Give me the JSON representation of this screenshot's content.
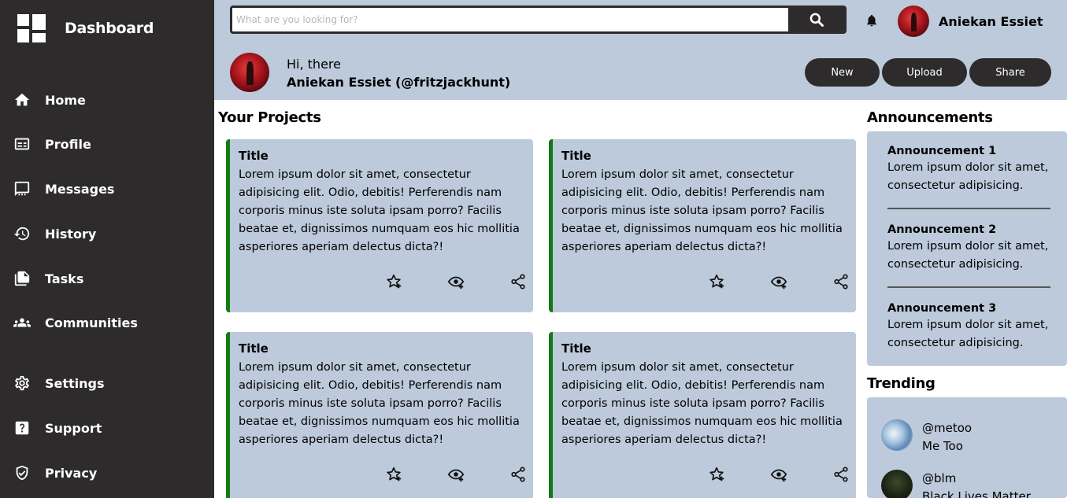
{
  "sidebar": {
    "brand_title": "Dashboard",
    "items": [
      {
        "label": "Home",
        "icon": "home-icon"
      },
      {
        "label": "Profile",
        "icon": "id-card-icon"
      },
      {
        "label": "Messages",
        "icon": "chat-icon"
      },
      {
        "label": "History",
        "icon": "history-icon"
      },
      {
        "label": "Tasks",
        "icon": "documents-icon"
      },
      {
        "label": "Communities",
        "icon": "people-icon"
      },
      {
        "label": "Settings",
        "icon": "gear-icon"
      },
      {
        "label": "Support",
        "icon": "help-icon"
      },
      {
        "label": "Privacy",
        "icon": "shield-icon"
      }
    ]
  },
  "header": {
    "search_placeholder": "What are you looking for?",
    "username": "Aniekan Essiet",
    "greeting": "Hi, there",
    "greeting_name": "Aniekan Essiet (@fritzjackhunt)",
    "buttons": {
      "new": "New",
      "upload": "Upload",
      "share": "Share"
    }
  },
  "projects": {
    "title": "Your Projects",
    "cards": [
      {
        "title": "Title",
        "body": "Lorem ipsum dolor sit amet, consectetur adipisicing elit. Odio, debitis! Perferendis nam corporis minus iste soluta ipsam porro? Facilis beatae et, dignissimos numquam eos hic mollitia asperiores aperiam delectus dicta?!"
      },
      {
        "title": "Title",
        "body": "Lorem ipsum dolor sit amet, consectetur adipisicing elit. Odio, debitis! Perferendis nam corporis minus iste soluta ipsam porro? Facilis beatae et, dignissimos numquam eos hic mollitia asperiores aperiam delectus dicta?!"
      },
      {
        "title": "Title",
        "body": "Lorem ipsum dolor sit amet, consectetur adipisicing elit. Odio, debitis! Perferendis nam corporis minus iste soluta ipsam porro? Facilis beatae et, dignissimos numquam eos hic mollitia asperiores aperiam delectus dicta?!"
      },
      {
        "title": "Title",
        "body": "Lorem ipsum dolor sit amet, consectetur adipisicing elit. Odio, debitis! Perferendis nam corporis minus iste soluta ipsam porro? Facilis beatae et, dignissimos numquam eos hic mollitia asperiores aperiam delectus dicta?!"
      }
    ]
  },
  "announcements": {
    "title": "Announcements",
    "items": [
      {
        "title": "Announcement 1",
        "body": "Lorem ipsum dolor sit amet, consectetur adipisicing."
      },
      {
        "title": "Announcement 2",
        "body": "Lorem ipsum dolor sit amet, consectetur adipisicing."
      },
      {
        "title": "Announcement 3",
        "body": "Lorem ipsum dolor sit amet, consectetur adipisicing."
      }
    ]
  },
  "trending": {
    "title": "Trending",
    "items": [
      {
        "handle": "@metoo",
        "name": "Me Too"
      },
      {
        "handle": "@blm",
        "name": "Black Lives Matter"
      }
    ]
  },
  "colors": {
    "sidebar_bg": "#2d2b2c",
    "panel_bg": "#bccadb",
    "card_accent": "#157a12"
  }
}
